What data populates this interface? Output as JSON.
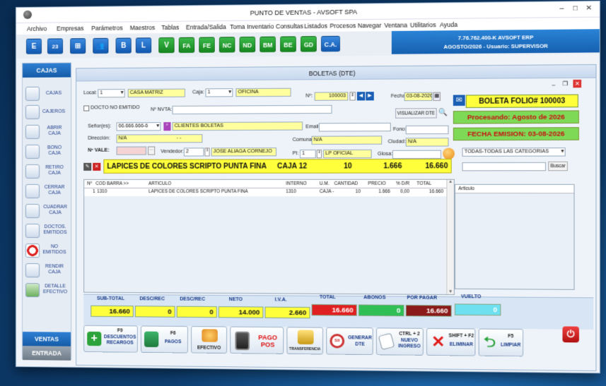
{
  "window": {
    "title": "PUNTO DE VENTAS - AVSOFT SPA"
  },
  "menu": [
    "Archivo",
    "Empresas",
    "Parámetros",
    "Maestros",
    "Tablas",
    "Entrada/Salida",
    "Toma Inventario",
    "Consultas",
    "Listados",
    "Procesos",
    "Navegar",
    "Ventana",
    "Utilitarios",
    "Ayuda"
  ],
  "toolbar": {
    "buttons": [
      "E",
      "23",
      "",
      "",
      "B",
      "L",
      "V",
      "FA",
      "FE",
      "NC",
      "ND",
      "BM",
      "BE",
      "GD",
      "C.A."
    ]
  },
  "company": {
    "line1": "7.76.762.400-K  AVSOFT ERP",
    "line2": "AGOSTO/2026 -  Usuario: SUPERVISOR"
  },
  "sidebar": {
    "header": "CAJAS",
    "items": [
      "CAJAS",
      "CAJEROS",
      "ABRIR CAJA",
      "BONO CAJA",
      "RETIRO CAJA",
      "CERRAR CAJA",
      "CUADRAR CAJA",
      "DOCTOS. EMITIDOS",
      "NO EMITIDOS",
      "RENDIR CAJA",
      "DETALLE EFECTIVO"
    ],
    "ventas": "VENTAS",
    "entrada": "ENTRADA"
  },
  "form": {
    "title": "BOLETAS (DTE)",
    "local_label": "Local:",
    "local_num": "1",
    "local_name": "CASA MATRIZ",
    "caja_label": "Caja:",
    "caja_num": "1",
    "caja_name": "OFICINA",
    "no_label": "Nº:",
    "no_value": "100003",
    "fecha_label": "Fecha:",
    "fecha_value": "03-08-2026",
    "docto_no_emitido": "DOCTO NO EMITIDO",
    "nvta_label": "Nº NVTA:",
    "visualizar": "VISUALIZAR DTE",
    "senores_label": "Señor(es):",
    "rut": "66.666.666-6",
    "cliente": "CLIENTES BOLETAS",
    "email_label": "Email:",
    "fono_label": "Fono:",
    "direccion_label": "Dirección:",
    "direccion": "N/A",
    "direccion_extra": "- -",
    "comuna_label": "Comuna:",
    "comuna": "N/A",
    "ciudad_label": "Ciudad:",
    "ciudad": "N/A",
    "vale_label": "Nº VALE:",
    "vendedor_label": "Vendedor:",
    "vendedor_num": "2",
    "vendedor_name": "JOSE ALIAGA CORNEJO",
    "pl_label": "Pl:",
    "pl_num": "1",
    "pl_name": "LP OFICIAL",
    "glosa_label": "Glosa:"
  },
  "info": {
    "folio": "BOLETA FOLIO# 100003",
    "procesando": "Procesando: Agosto de 2026",
    "fecha_emision": "FECHA EMISION: 03-08-2026",
    "categoria": "TODAS-TODAS LAS CATEGORIAS",
    "buscar": "Buscar",
    "articulo_header": "Articulo"
  },
  "banner": {
    "product": "LAPICES DE COLORES SCRIPTO PUNTA FINA",
    "caja": "CAJA 12",
    "qty": "10",
    "price": "1.666",
    "total": "16.660"
  },
  "grid": {
    "headers": [
      "Nº",
      "COD BARRA >>",
      "ARTICULO",
      "INTERNO",
      "U.M.",
      "CANTIDAD",
      "PRECIO",
      "% D/R",
      "TOTAL"
    ],
    "rows": [
      [
        "1",
        "1310",
        "LAPICES DE COLORES SCRIPTO PUNTA FINA",
        "1310",
        "CAJA -",
        "10",
        "1.666",
        "0,00",
        "16.660"
      ]
    ]
  },
  "totals": {
    "subtotal_label": "SUB-TOTAL",
    "subtotal": "16.660",
    "descrec1_label": "DESC/REC",
    "descrec1": "0",
    "descrec2_label": "DESC/REC",
    "descrec2": "0",
    "neto_label": "NETO",
    "neto": "14.000",
    "iva_label": "I.V.A.",
    "iva": "2.660",
    "total_label": "TOTAL",
    "total": "16.660",
    "abonos_label": "ABONOS",
    "abonos": "0",
    "porpagar_label": "POR PAGAR",
    "porpagar": "16.660",
    "vuelto_label": "VUELTO",
    "vuelto": "0"
  },
  "actions": [
    {
      "key": "F9",
      "name": "DESCUENTOS RECARGOS"
    },
    {
      "key": "F6",
      "name": "PAGOS"
    },
    {
      "key": "",
      "name": "EFECTIVO"
    },
    {
      "key": "",
      "name": "PAGO POS"
    },
    {
      "key": "",
      "name": "TRANSFERENCIA"
    },
    {
      "key": "",
      "name": "GENERAR DTE"
    },
    {
      "key": "CTRL + 2",
      "name": "NUEVO INGRESO"
    },
    {
      "key": "SHIFT + F2",
      "name": "ELIMINAR"
    },
    {
      "key": "F5",
      "name": "LIMPIAR"
    }
  ],
  "colors": {
    "accent": "#1660b0",
    "green": "#7ed957",
    "yellow": "#ffff3c",
    "red": "#e02020",
    "maroon": "#8b1a1a"
  }
}
